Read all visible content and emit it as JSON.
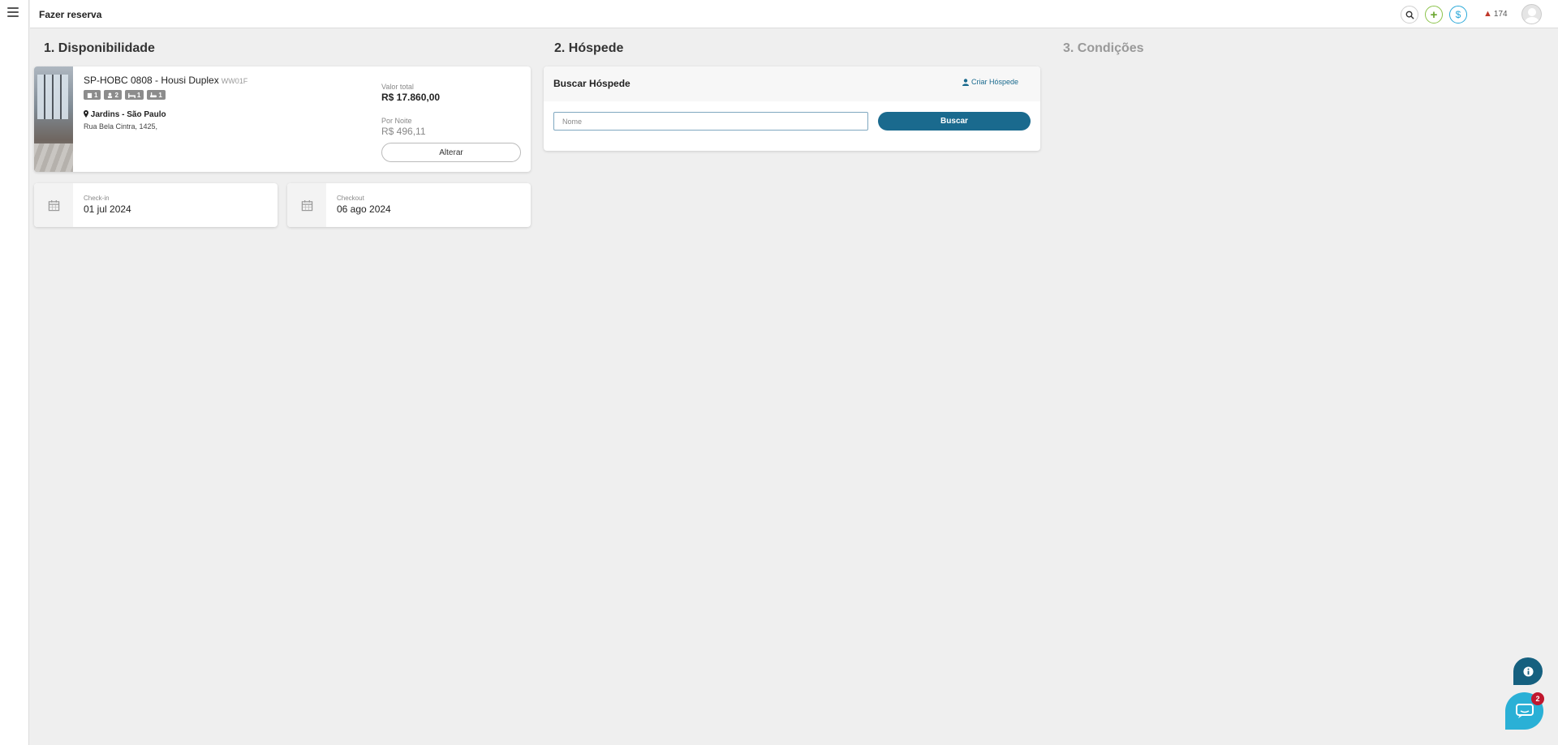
{
  "header": {
    "title": "Fazer reserva",
    "alert_count": "174"
  },
  "sections": {
    "s1": "1. Disponibilidade",
    "s2": "2. Hóspede",
    "s3": "3. Condições"
  },
  "property": {
    "name": "SP-HOBC 0808 - Housi Duplex",
    "code": "WW01F",
    "badges": {
      "units": "1",
      "guests": "2",
      "beds": "1",
      "baths": "1"
    },
    "location": "Jardins - São Paulo",
    "address": "Rua Bela Cintra, 1425,",
    "total_label": "Valor total",
    "total_value": "R$ 17.860,00",
    "night_label": "Por Noite",
    "night_value": "R$ 496,11",
    "change_label": "Alterar"
  },
  "dates": {
    "checkin_label": "Check-in",
    "checkin_value": "01 jul 2024",
    "checkout_label": "Checkout",
    "checkout_value": "06 ago 2024"
  },
  "guest": {
    "title": "Buscar Hóspede",
    "create_label": "Criar Hóspede",
    "name_placeholder": "Nome",
    "search_label": "Buscar"
  },
  "chat": {
    "badge_count": "2"
  },
  "colors": {
    "primary": "#1a6a8e",
    "chat": "#2ab0d6",
    "accent_green": "#8bc34a",
    "accent_blue": "#29a8d8",
    "alert": "#c0392b",
    "badge_red": "#c0172e"
  }
}
